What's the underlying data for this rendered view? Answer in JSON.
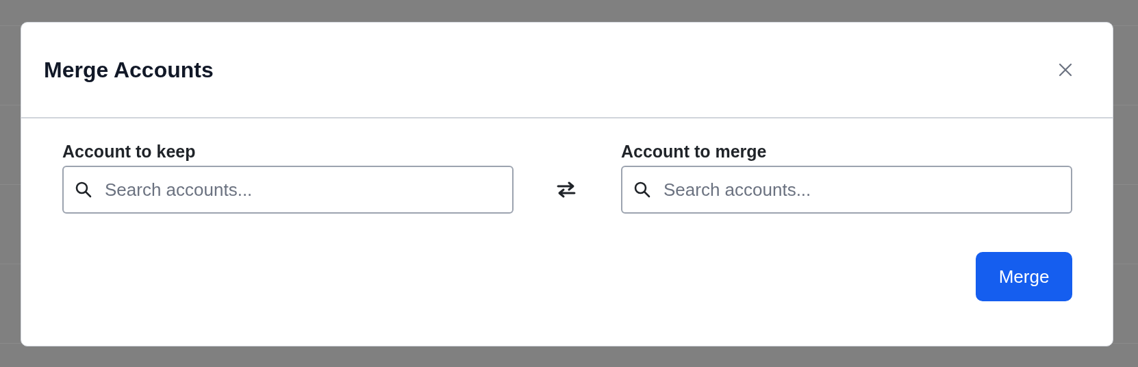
{
  "dialog": {
    "title": "Merge Accounts",
    "fields": [
      {
        "label": "Account to keep",
        "placeholder": "Search accounts..."
      },
      {
        "label": "Account to merge",
        "placeholder": "Search accounts..."
      }
    ],
    "buttons": [
      "Merge"
    ]
  }
}
